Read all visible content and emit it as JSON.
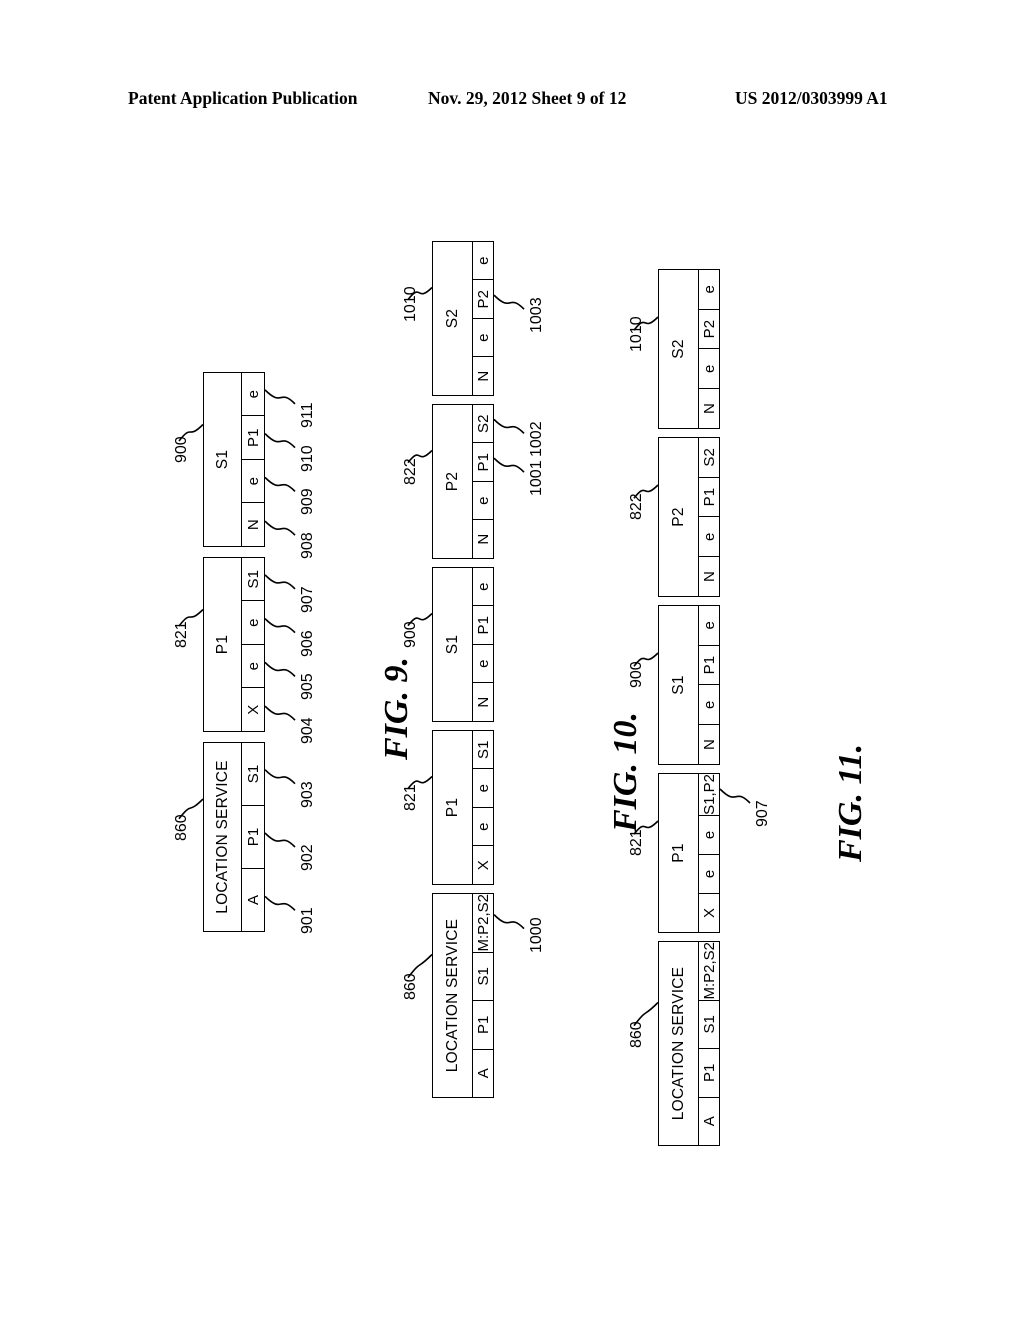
{
  "header": {
    "left": "Patent Application Publication",
    "middle": "Nov. 29, 2012  Sheet 9 of 12",
    "right": "US 2012/0303999 A1"
  },
  "figures": [
    {
      "caption": "FIG. 9.",
      "nodes": [
        {
          "label": "LOCATION SERVICE",
          "ref": "860",
          "cells": [
            {
              "text": "A",
              "ref": "901"
            },
            {
              "text": "P1",
              "ref": "902"
            },
            {
              "text": "S1",
              "ref": "903"
            }
          ]
        },
        {
          "label": "P1",
          "ref": "821",
          "cells": [
            {
              "text": "X",
              "ref": "904"
            },
            {
              "text": "e",
              "ref": "905"
            },
            {
              "text": "e",
              "ref": "906"
            },
            {
              "text": "S1",
              "ref": "907"
            }
          ]
        },
        {
          "label": "S1",
          "ref": "900",
          "cells": [
            {
              "text": "N",
              "ref": "908"
            },
            {
              "text": "e",
              "ref": "909"
            },
            {
              "text": "P1",
              "ref": "910"
            },
            {
              "text": "e",
              "ref": "911"
            }
          ]
        }
      ]
    },
    {
      "caption": "FIG. 10.",
      "nodes": [
        {
          "label": "LOCATION SERVICE",
          "ref": "860",
          "cells": [
            {
              "text": "A",
              "ref": ""
            },
            {
              "text": "P1",
              "ref": ""
            },
            {
              "text": "S1",
              "ref": ""
            },
            {
              "text": "M:P2,S2",
              "ref": "1000"
            }
          ]
        },
        {
          "label": "P1",
          "ref": "821",
          "cells": [
            {
              "text": "X",
              "ref": ""
            },
            {
              "text": "e",
              "ref": ""
            },
            {
              "text": "e",
              "ref": ""
            },
            {
              "text": "S1",
              "ref": ""
            }
          ]
        },
        {
          "label": "S1",
          "ref": "900",
          "cells": [
            {
              "text": "N",
              "ref": ""
            },
            {
              "text": "e",
              "ref": ""
            },
            {
              "text": "P1",
              "ref": ""
            },
            {
              "text": "e",
              "ref": ""
            }
          ]
        },
        {
          "label": "P2",
          "ref": "822",
          "cells": [
            {
              "text": "N",
              "ref": ""
            },
            {
              "text": "e",
              "ref": ""
            },
            {
              "text": "P1",
              "ref": "1001"
            },
            {
              "text": "S2",
              "ref": "1002"
            }
          ]
        },
        {
          "label": "S2",
          "ref": "1010",
          "cells": [
            {
              "text": "N",
              "ref": ""
            },
            {
              "text": "e",
              "ref": ""
            },
            {
              "text": "P2",
              "ref": "1003"
            },
            {
              "text": "e",
              "ref": ""
            }
          ]
        }
      ]
    },
    {
      "caption": "FIG. 11.",
      "nodes": [
        {
          "label": "LOCATION SERVICE",
          "ref": "860",
          "cells": [
            {
              "text": "A",
              "ref": ""
            },
            {
              "text": "P1",
              "ref": ""
            },
            {
              "text": "S1",
              "ref": ""
            },
            {
              "text": "M:P2,S2",
              "ref": ""
            }
          ]
        },
        {
          "label": "P1",
          "ref": "821",
          "cells": [
            {
              "text": "X",
              "ref": ""
            },
            {
              "text": "e",
              "ref": ""
            },
            {
              "text": "e",
              "ref": ""
            },
            {
              "text": "S1,P2",
              "ref": "907"
            }
          ]
        },
        {
          "label": "S1",
          "ref": "900",
          "cells": [
            {
              "text": "N",
              "ref": ""
            },
            {
              "text": "e",
              "ref": ""
            },
            {
              "text": "P1",
              "ref": ""
            },
            {
              "text": "e",
              "ref": ""
            }
          ]
        },
        {
          "label": "P2",
          "ref": "822",
          "cells": [
            {
              "text": "N",
              "ref": ""
            },
            {
              "text": "e",
              "ref": ""
            },
            {
              "text": "P1",
              "ref": ""
            },
            {
              "text": "S2",
              "ref": ""
            }
          ]
        },
        {
          "label": "S2",
          "ref": "1010",
          "cells": [
            {
              "text": "N",
              "ref": ""
            },
            {
              "text": "e",
              "ref": ""
            },
            {
              "text": "P2",
              "ref": ""
            },
            {
              "text": "e",
              "ref": ""
            }
          ]
        }
      ]
    }
  ]
}
